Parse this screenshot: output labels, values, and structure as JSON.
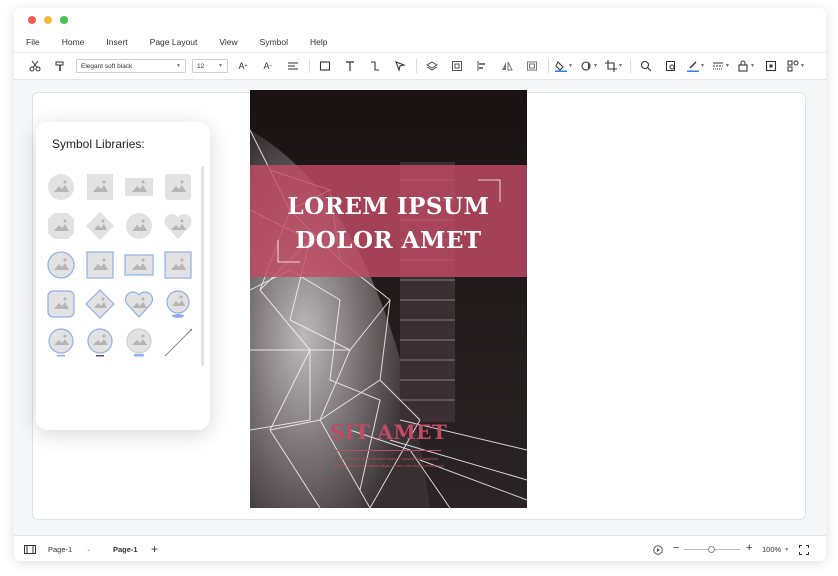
{
  "menu": [
    "File",
    "Home",
    "Insert",
    "Page Layout",
    "View",
    "Symbol",
    "Help"
  ],
  "toolbar": {
    "font": "Elegant soft black",
    "size": "12",
    "icons": [
      "cut-icon",
      "format-painter-icon",
      "font-grow-icon",
      "font-shrink-icon",
      "align-icon",
      "rectangle-icon",
      "text-icon",
      "connector-icon",
      "pointer-icon",
      "layers-icon",
      "group-icon",
      "align-left-icon",
      "flip-icon",
      "frame-icon",
      "fill-icon",
      "shadow-icon",
      "crop-icon",
      "search-icon",
      "find-replace-icon",
      "line-color-icon",
      "line-style-icon",
      "lock-icon",
      "fit-icon",
      "more-icon"
    ]
  },
  "symbol_panel": {
    "title": "Symbol Libraries:"
  },
  "poster": {
    "headline_line1": "LOREM IPSUM",
    "headline_line2": "DOLOR AMET",
    "subtitle": "SIT AMET",
    "small_text_line1": "lorem ipsum dolor sit amet dictum, consectetur adipiscin",
    "small_text_line2": "ut labore et dolore magna aliqua ut enim ad minim veniam quis",
    "accent_color": "#c14a64"
  },
  "statusbar": {
    "page_select": "Page-1",
    "page_tab": "Page-1",
    "add_page": "+",
    "zoom_minus": "−",
    "zoom_plus": "+",
    "zoom_level": "100%"
  }
}
